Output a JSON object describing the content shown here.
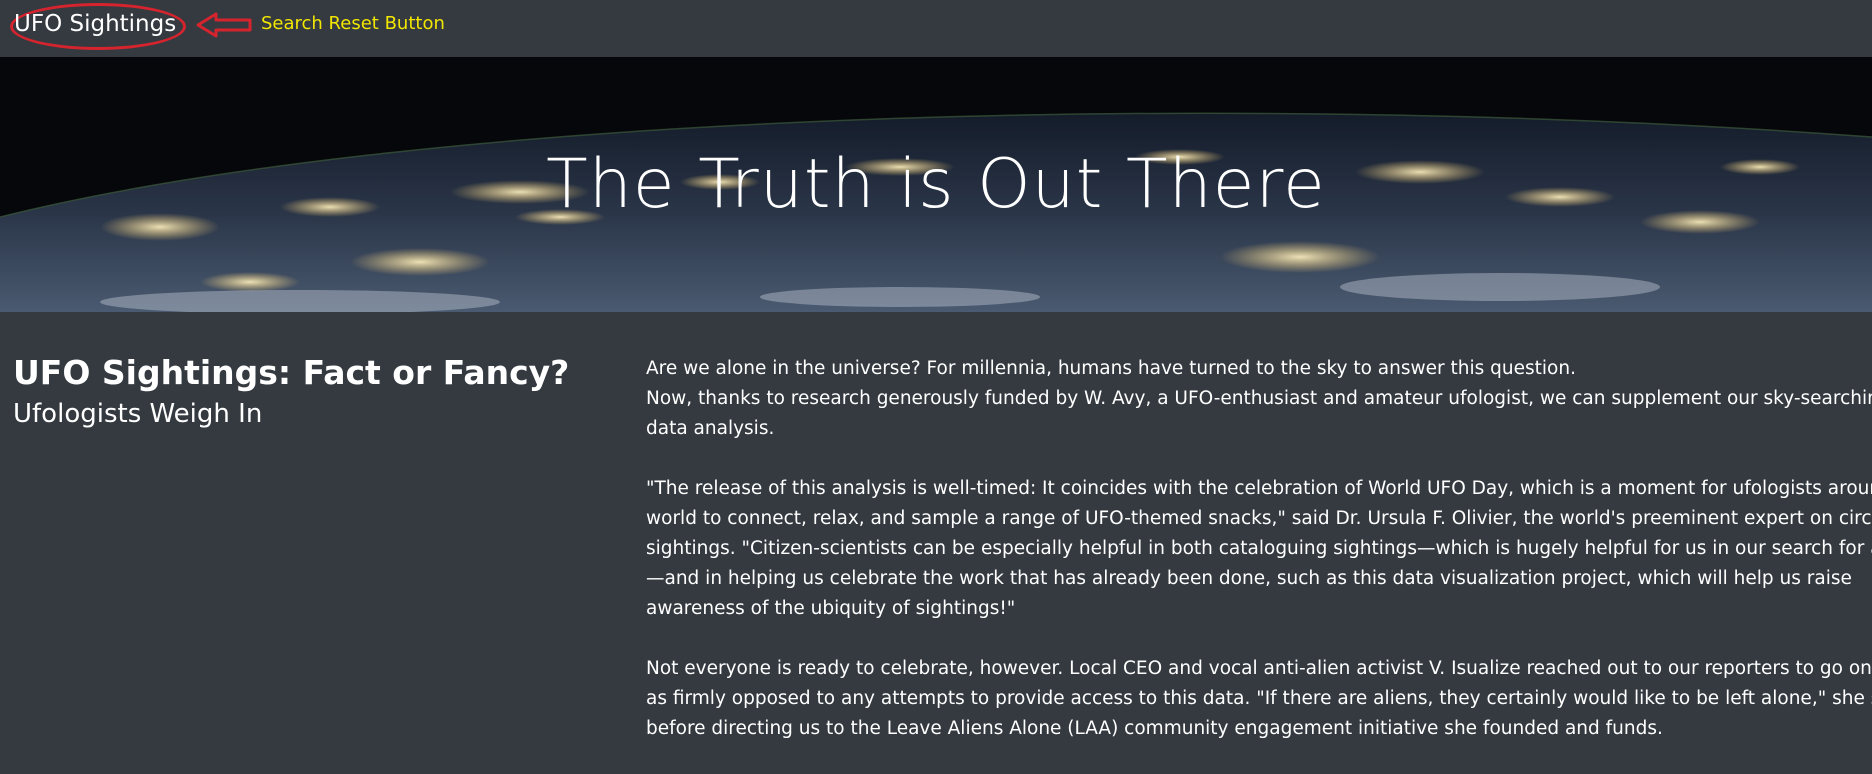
{
  "navbar": {
    "brand": "UFO Sightings"
  },
  "annotation": {
    "label": "Search Reset Button",
    "color": "#d6242e",
    "text_color": "#f2e600"
  },
  "hero": {
    "title": "The Truth is Out There"
  },
  "article": {
    "heading": "UFO Sightings: Fact or Fancy?",
    "subheading": "Ufologists Weigh In",
    "paragraphs": [
      {
        "lines": [
          "Are we alone in the universe? For millennia, humans have turned to the sky to answer this question.",
          "Now, thanks to research generously funded by W. Avy, a UFO-enthusiast and amateur ufologist, we can supplement our sky-searching with",
          "data analysis."
        ]
      },
      {
        "lines": [
          "\"The release of this analysis is well-timed: It coincides with the celebration of World UFO Day, which is a moment for ufologists around the",
          "world to connect, relax, and sample a range of UFO-themed snacks,\" said Dr. Ursula F. Olivier, the world's preeminent expert on circular",
          "sightings. \"Citizen-scientists can be especially helpful in both cataloguing sightings—which is hugely helpful for us in our search for aliens",
          "—and in helping us celebrate the work that has already been done, such as this data visualization project, which will help us raise",
          "awareness of the ubiquity of sightings!\""
        ]
      },
      {
        "lines": [
          "Not everyone is ready to celebrate, however. Local CEO and vocal anti-alien activist V. Isualize reached out to our reporters to go on record",
          "as firmly opposed to any attempts to provide access to this data. \"If there are aliens, they certainly would like to be left alone,\" she stated,",
          "before directing us to the Leave Aliens Alone (LAA) community engagement initiative she founded and funds."
        ]
      }
    ]
  }
}
